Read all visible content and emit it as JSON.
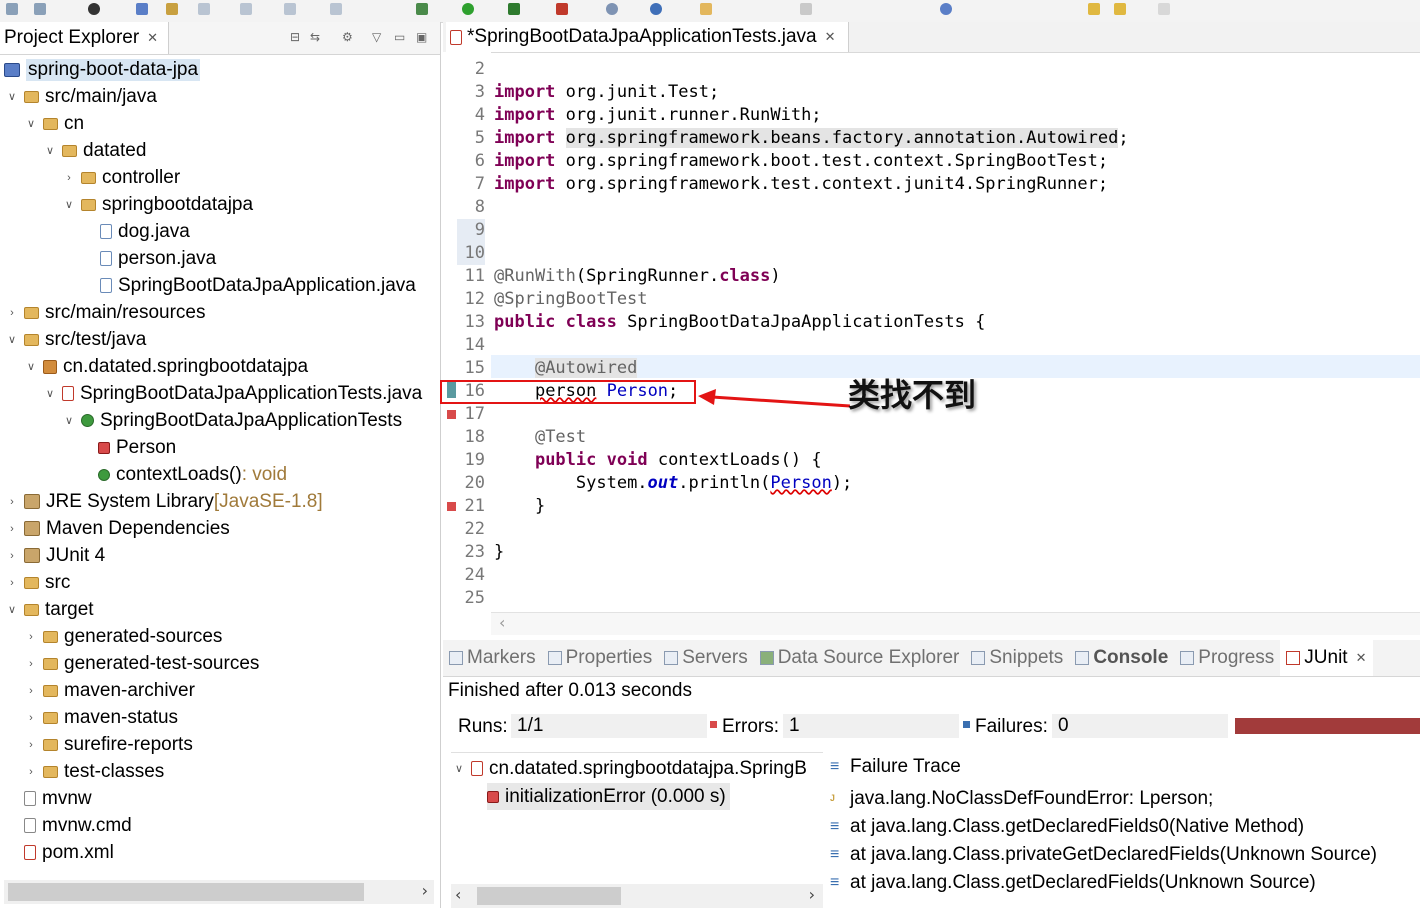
{
  "colors": {
    "error_bar": "#a23b3b",
    "highlight_box": "#e31414",
    "keyword": "#7f0055",
    "annotation": "#646464",
    "field": "#0000c0"
  },
  "explorer": {
    "tab_label": "Project Explorer",
    "tree": [
      {
        "label": "spring-boot-data-jpa",
        "icon": "project-icon"
      },
      {
        "label": "src/main/java",
        "icon": "source-folder-icon"
      },
      {
        "label": "cn",
        "icon": "folder-icon"
      },
      {
        "label": "datated",
        "icon": "folder-icon"
      },
      {
        "label": "controller",
        "icon": "folder-icon"
      },
      {
        "label": "springbootdatajpa",
        "icon": "folder-icon"
      },
      {
        "label": "dog.java",
        "icon": "java-file-icon"
      },
      {
        "label": "person.java",
        "icon": "java-file-icon"
      },
      {
        "label": "SpringBootDataJpaApplication.java",
        "icon": "java-file-icon"
      },
      {
        "label": "src/main/resources",
        "icon": "source-folder-icon"
      },
      {
        "label": "src/test/java",
        "icon": "source-folder-error-icon"
      },
      {
        "label": "cn.datated.springbootdatajpa",
        "icon": "package-error-icon"
      },
      {
        "label": "SpringBootDataJpaApplicationTests.java",
        "icon": "java-file-error-icon"
      },
      {
        "label": "SpringBootDataJpaApplicationTests",
        "icon": "class-icon"
      },
      {
        "label": "Person",
        "icon": "field-error-icon"
      },
      {
        "label": "contextLoads()",
        "suffix": " : void",
        "icon": "method-icon"
      },
      {
        "label": "JRE System Library",
        "suffix": " [JavaSE-1.8]",
        "icon": "library-icon"
      },
      {
        "label": "Maven Dependencies",
        "icon": "library-icon"
      },
      {
        "label": "JUnit 4",
        "icon": "library-icon"
      },
      {
        "label": "src",
        "icon": "folder-error-icon"
      },
      {
        "label": "target",
        "icon": "folder-icon"
      },
      {
        "label": "generated-sources",
        "icon": "folder-icon"
      },
      {
        "label": "generated-test-sources",
        "icon": "folder-icon"
      },
      {
        "label": "maven-archiver",
        "icon": "folder-icon"
      },
      {
        "label": "maven-status",
        "icon": "folder-icon"
      },
      {
        "label": "surefire-reports",
        "icon": "folder-icon"
      },
      {
        "label": "test-classes",
        "icon": "folder-icon"
      },
      {
        "label": "mvnw",
        "icon": "text-file-icon"
      },
      {
        "label": "mvnw.cmd",
        "icon": "text-file-icon"
      },
      {
        "label": "pom.xml",
        "icon": "xml-file-error-icon"
      }
    ]
  },
  "editor": {
    "tab_label": "*SpringBootDataJpaApplicationTests.java",
    "line_numbers": [
      "2",
      "3",
      "4",
      "5",
      "6",
      "7",
      "8",
      "9",
      "10",
      "11",
      "12",
      "13",
      "14",
      "15",
      "16",
      "17",
      "18",
      "19",
      "20",
      "21",
      "22",
      "23",
      "24",
      "25"
    ],
    "imports": {
      "l3": "org.junit.Test;",
      "l4": "org.junit.runner.RunWith;",
      "l5": "org.springframework.beans.factory.annotation.Autowired",
      "l6": "org.springframework.boot.test.context.SpringBootTest;",
      "l7": "org.springframework.test.context.junit4.SpringRunner;"
    },
    "kw_import": "import",
    "kw_public": "public",
    "kw_class": "class",
    "kw_void": "void",
    "kw_class_literal": "class",
    "runwith": "@RunWith",
    "runwith_arg": "(SpringRunner.",
    "runwith_end": ")",
    "springboottest": "@SpringBootTest",
    "class_name": "SpringBootDataJpaApplicationTests {",
    "autowired": "@Autowired",
    "field_type": "person",
    "field_name": "Person",
    "semicolon": ";",
    "test_ann": "@Test",
    "method_sig": "contextLoads() {",
    "sysout_a": "System.",
    "sysout_out": "out",
    "sysout_b": ".println(",
    "sysout_arg": "Person",
    "sysout_c": ");",
    "close_brace_method": "}",
    "close_brace_class": "}"
  },
  "annotation_note": "类找不到",
  "bottom": {
    "tabs": [
      "Markers",
      "Properties",
      "Servers",
      "Data Source Explorer",
      "Snippets",
      "Console",
      "Progress",
      "JUnit"
    ],
    "finished": "Finished after 0.013 seconds",
    "runs_label": "Runs:",
    "runs_value": "1/1",
    "errors_label": "Errors:",
    "errors_value": "1",
    "failures_label": "Failures:",
    "failures_value": "0",
    "tests": [
      {
        "label": "cn.datated.springbootdatajpa.SpringB"
      },
      {
        "label": "initializationError (0.000 s)"
      }
    ],
    "failure_trace_label": "Failure Trace",
    "trace": [
      "java.lang.NoClassDefFoundError: Lperson;",
      "at java.lang.Class.getDeclaredFields0(Native Method)",
      "at java.lang.Class.privateGetDeclaredFields(Unknown Source)",
      "at java.lang.Class.getDeclaredFields(Unknown Source)"
    ]
  }
}
